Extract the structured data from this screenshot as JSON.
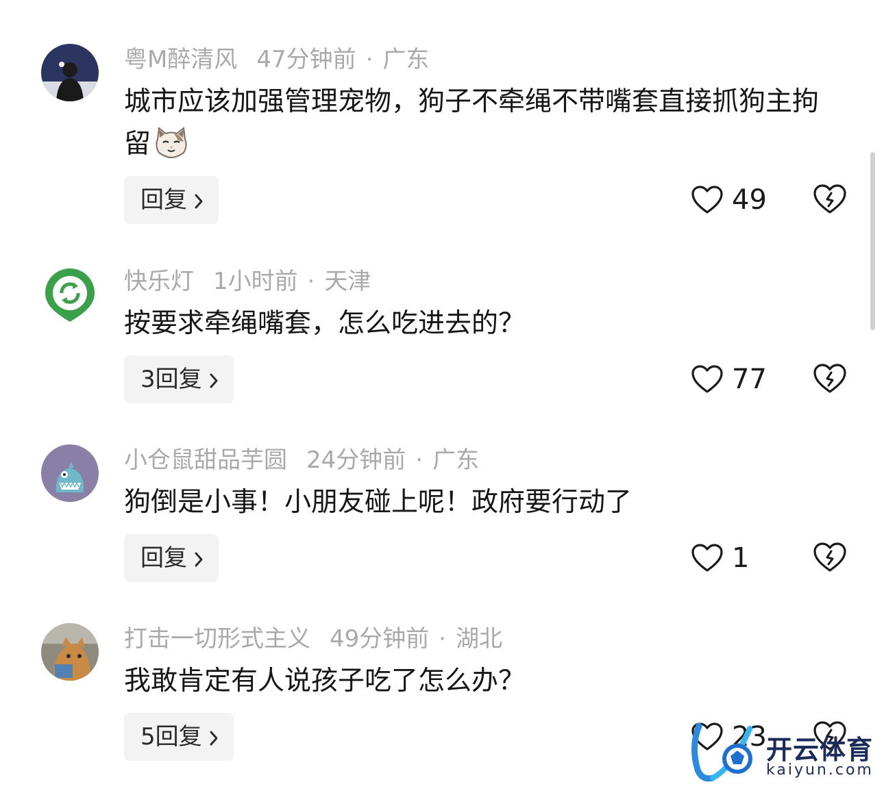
{
  "comments": [
    {
      "username": "粤M醉清风",
      "time": "47分钟前",
      "location": "广东",
      "text": "城市应该加强管理宠物，狗子不牵绳不带嘴套直接抓狗主拘留",
      "reply_label": "回复",
      "likes": "49",
      "avatar": "person-avatar"
    },
    {
      "username": "快乐灯",
      "time": "1小时前",
      "location": "天津",
      "text": "按要求牵绳嘴套，怎么吃进去的？",
      "reply_label": "3回复",
      "likes": "77",
      "avatar": "green-refresh-avatar"
    },
    {
      "username": "小仓鼠甜品芋圆",
      "time": "24分钟前",
      "location": "广东",
      "text": "狗倒是小事！小朋友碰上呢！政府要行动了",
      "reply_label": "回复",
      "likes": "1",
      "avatar": "purple-monster-avatar"
    },
    {
      "username": "打击一切形式主义",
      "time": "49分钟前",
      "location": "湖北",
      "text": "我敢肯定有人说孩子吃了怎么办？",
      "reply_label": "5回复",
      "likes": "23",
      "avatar": "cat-photo-avatar"
    }
  ],
  "separator": "·",
  "watermark": {
    "cn": "开云体育",
    "en": "kaiyun.com"
  },
  "colors": {
    "meta": "#a9a9a9",
    "text": "#161616",
    "reply_bg": "#f3f3f3",
    "watermark": "#1b2c5a"
  }
}
